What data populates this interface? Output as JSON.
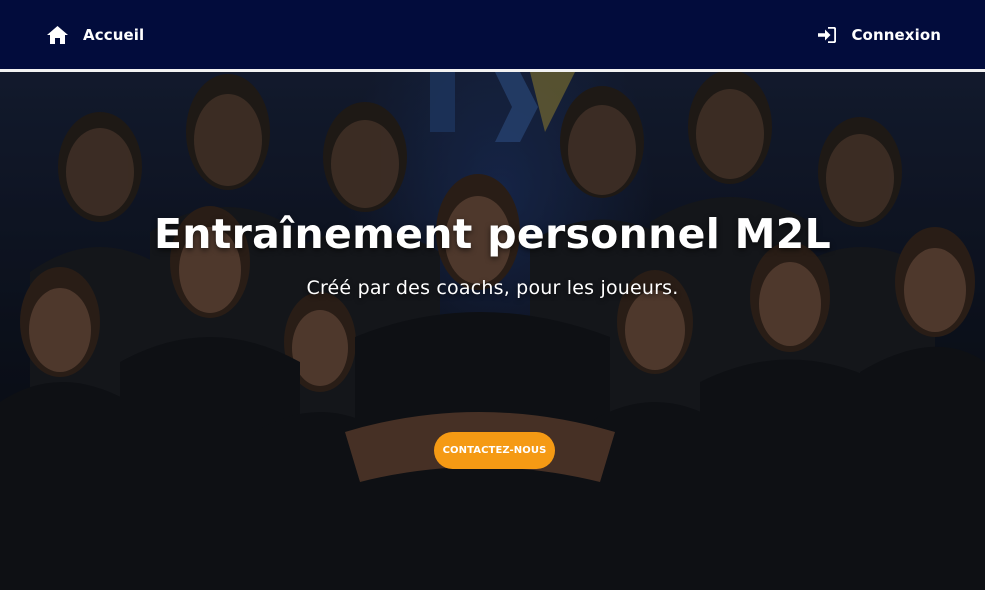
{
  "nav": {
    "home_icon": "home-icon",
    "home_label": "Accueil",
    "login_icon": "sign-in-icon",
    "login_label": "Connexion"
  },
  "hero": {
    "title": "Entraînement personnel M2L",
    "subtitle": "Créé par des coachs, pour les joueurs.",
    "cta_label": "CONTACTEZ-NOUS"
  },
  "colors": {
    "navbar_bg": "#020c3c",
    "cta_bg": "#f59a14",
    "text": "#ffffff"
  }
}
